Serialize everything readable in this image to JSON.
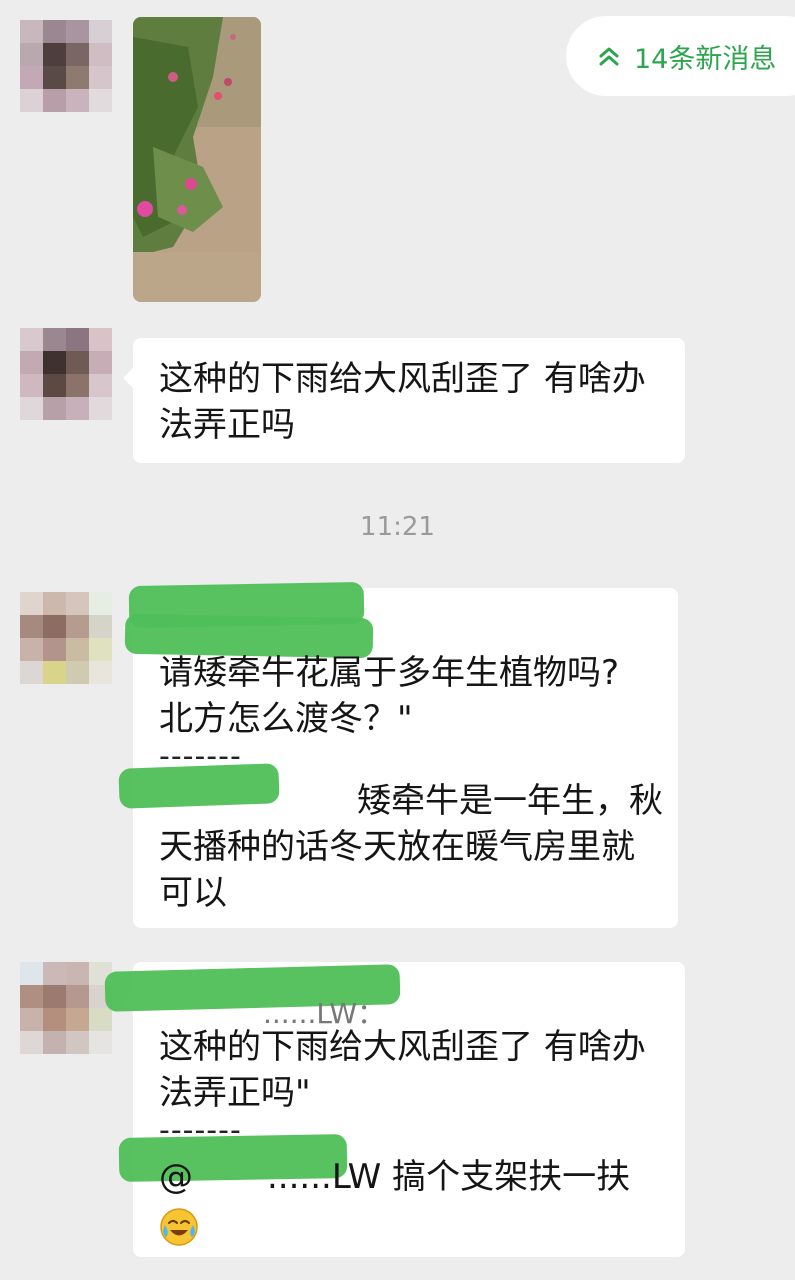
{
  "banner": {
    "new_messages": "14条新消息"
  },
  "time_divider": "11:21",
  "messages": [
    {
      "type": "image",
      "alt": ""
    },
    {
      "type": "text",
      "lines": [
        "这种的下雨给大风刮歪了 有啥办",
        "法弄正吗"
      ]
    },
    {
      "type": "quote_reply",
      "quote_lines": [
        "请矮牵牛花属于多年生植物吗?",
        "北方怎么渡冬？\""
      ],
      "separator": "-------",
      "reply_lines": [
        "矮牵牛是一年生，秋",
        "天播种的话冬天放在暖气房里就",
        "可以"
      ]
    },
    {
      "type": "quote_reply",
      "quote_header": "......LW：",
      "quote_lines": [
        "这种的下雨给大风刮歪了 有啥办",
        "法弄正吗\""
      ],
      "separator": "-------",
      "reply_prefix": "@",
      "reply_name": "......LW",
      "reply_lines": [
        "搞个支架扶一扶"
      ],
      "reply_emoji": "crying-laughing-emoji"
    }
  ],
  "colors": {
    "accent": "#2da44e",
    "background": "#ededed",
    "bubble": "#ffffff",
    "redaction": "#4fbf58"
  }
}
